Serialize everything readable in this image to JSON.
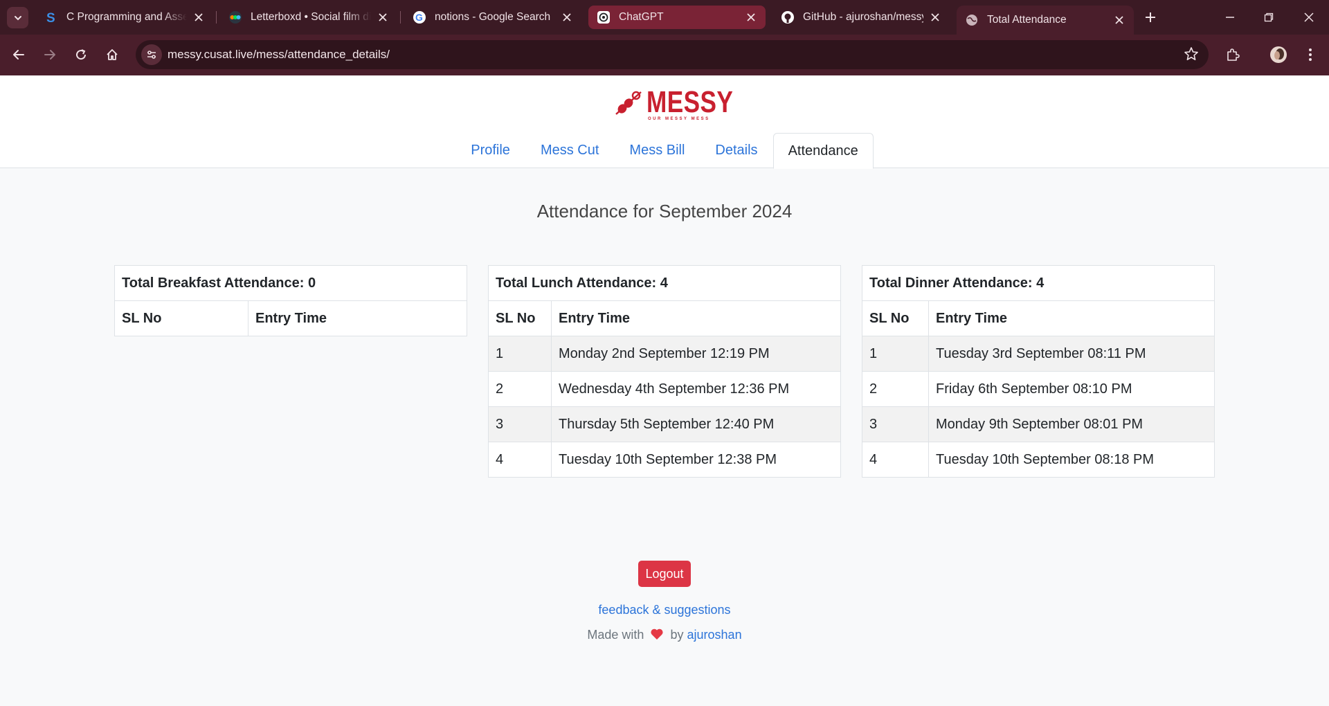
{
  "browser": {
    "tabs": [
      {
        "title": "C Programming and Assembly",
        "icon": "s-icon"
      },
      {
        "title": "Letterboxd • Social film discovery",
        "icon": "letterboxd-icon"
      },
      {
        "title": "notions - Google Search",
        "icon": "google-icon"
      },
      {
        "title": "ChatGPT",
        "icon": "chatgpt-icon"
      },
      {
        "title": "GitHub - ajuroshan/messy",
        "icon": "github-icon"
      },
      {
        "title": "Total Attendance",
        "icon": "globe-icon"
      }
    ],
    "url": "messy.cusat.live/mess/attendance_details/",
    "colors": {
      "frame": "#3b1a24",
      "toolbar": "#4a1e2b",
      "highlight_tab": "#7a2336"
    }
  },
  "site": {
    "logo_text": "MESSY",
    "logo_tagline": "OUR MESSY MESS",
    "nav": [
      {
        "label": "Profile"
      },
      {
        "label": "Mess Cut"
      },
      {
        "label": "Mess Bill"
      },
      {
        "label": "Details"
      },
      {
        "label": "Attendance"
      }
    ],
    "active_nav": "Attendance",
    "colors": {
      "brand": "#c8202f",
      "link": "#2c74d9",
      "danger": "#dc3545"
    }
  },
  "main": {
    "title": "Attendance for September 2024",
    "column_headers": {
      "sl": "SL No",
      "time": "Entry Time"
    },
    "breakfast": {
      "caption": "Total Breakfast Attendance: 0",
      "rows": []
    },
    "lunch": {
      "caption": "Total Lunch Attendance: 4",
      "rows": [
        {
          "sl": "1",
          "time": "Monday 2nd September 12:19 PM"
        },
        {
          "sl": "2",
          "time": "Wednesday 4th September 12:36 PM"
        },
        {
          "sl": "3",
          "time": "Thursday 5th September 12:40 PM"
        },
        {
          "sl": "4",
          "time": "Tuesday 10th September 12:38 PM"
        }
      ]
    },
    "dinner": {
      "caption": "Total Dinner Attendance: 4",
      "rows": [
        {
          "sl": "1",
          "time": "Tuesday 3rd September 08:11 PM"
        },
        {
          "sl": "2",
          "time": "Friday 6th September 08:10 PM"
        },
        {
          "sl": "3",
          "time": "Monday 9th September 08:01 PM"
        },
        {
          "sl": "4",
          "time": "Tuesday 10th September 08:18 PM"
        }
      ]
    }
  },
  "footer": {
    "logout_label": "Logout",
    "feedback_label": "feedback & suggestions",
    "made_with_prefix": "Made with",
    "made_with_by": "by",
    "author": "ajuroshan",
    "heart_icon": "heart-icon",
    "heart_color": "#e53945"
  }
}
